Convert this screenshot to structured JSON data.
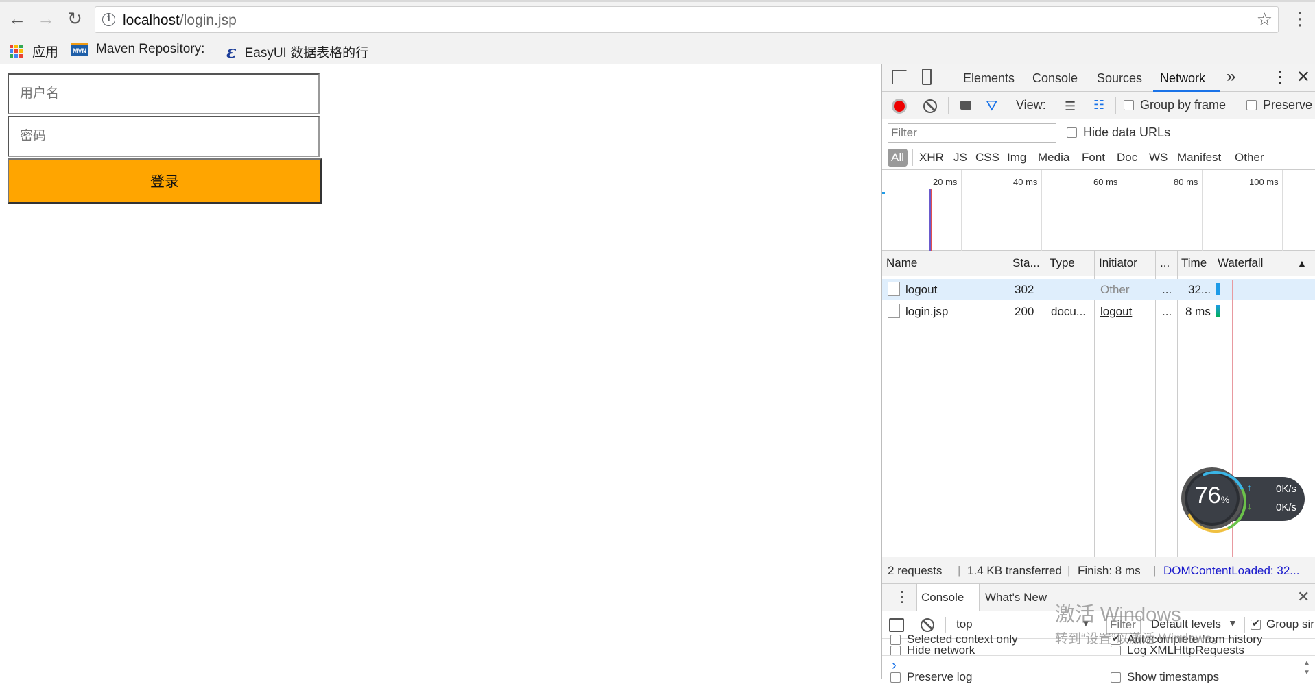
{
  "browser": {
    "url_host": "localhost",
    "url_path": "/login.jsp",
    "bookmarks": [
      {
        "label": "应用",
        "icon": "apps-grid-icon"
      },
      {
        "label": "Maven Repository:",
        "icon": "mvn-icon"
      },
      {
        "label": "EasyUI 数据表格的行",
        "icon": "easyui-icon"
      }
    ]
  },
  "page": {
    "username_placeholder": "用户名",
    "password_placeholder": "密码",
    "login_label": "登录",
    "login_color": "#ffa500"
  },
  "devtools": {
    "tabs": [
      "Elements",
      "Console",
      "Sources",
      "Network"
    ],
    "active_tab": "Network",
    "more_tabs": "»",
    "network_toolbar": {
      "view_label": "View:",
      "group_by_frame": "Group by frame",
      "preserve": "Preserve"
    },
    "filter": {
      "placeholder": "Filter",
      "hide_data_urls": "Hide data URLs"
    },
    "types": [
      "All",
      "XHR",
      "JS",
      "CSS",
      "Img",
      "Media",
      "Font",
      "Doc",
      "WS",
      "Manifest",
      "Other"
    ],
    "overview_ticks": [
      "20 ms",
      "40 ms",
      "60 ms",
      "80 ms",
      "100 ms"
    ],
    "columns": [
      "Name",
      "Sta...",
      "Type",
      "Initiator",
      "...",
      "Time",
      "Waterfall"
    ],
    "requests": [
      {
        "name": "logout",
        "status": "302",
        "type": "",
        "initiator": "Other",
        "size": "...",
        "time": "32...",
        "selected": true
      },
      {
        "name": "login.jsp",
        "status": "200",
        "type": "docu...",
        "initiator": "logout",
        "size": "...",
        "time": "8 ms",
        "selected": false
      }
    ],
    "summary": {
      "requests": "2 requests",
      "transferred": "1.4 KB transferred",
      "finish": "Finish: 8 ms",
      "dom": "DOMContentLoaded: 32..."
    },
    "drawer_tabs": [
      "Console",
      "What's New"
    ],
    "console_toolbar": {
      "context": "top",
      "filter_placeholder": "Filter",
      "levels": "Default levels",
      "group": "Group sir"
    },
    "console_settings": [
      {
        "label": "Hide network",
        "checked": false
      },
      {
        "label": "Log XMLHttpRequests",
        "checked": false
      },
      {
        "label": "Preserve log",
        "checked": false
      },
      {
        "label": "Show timestamps",
        "checked": false
      },
      {
        "label": "Selected context only",
        "checked": false
      },
      {
        "label": "Autocomplete from history",
        "checked": true
      }
    ],
    "prompt": "›"
  },
  "speed_widget": {
    "percent": "76",
    "percent_unit": "%",
    "upload": "0K/s",
    "download": "0K/s"
  },
  "watermark": {
    "line1": "激活 Windows",
    "line2": "转到“设置”以激活 Windows。"
  },
  "colors": {
    "accent_blue": "#1a73e8",
    "record_red": "#e00000",
    "waterfall_blue": "#1e9be8",
    "waterfall_green": "#00b050"
  }
}
